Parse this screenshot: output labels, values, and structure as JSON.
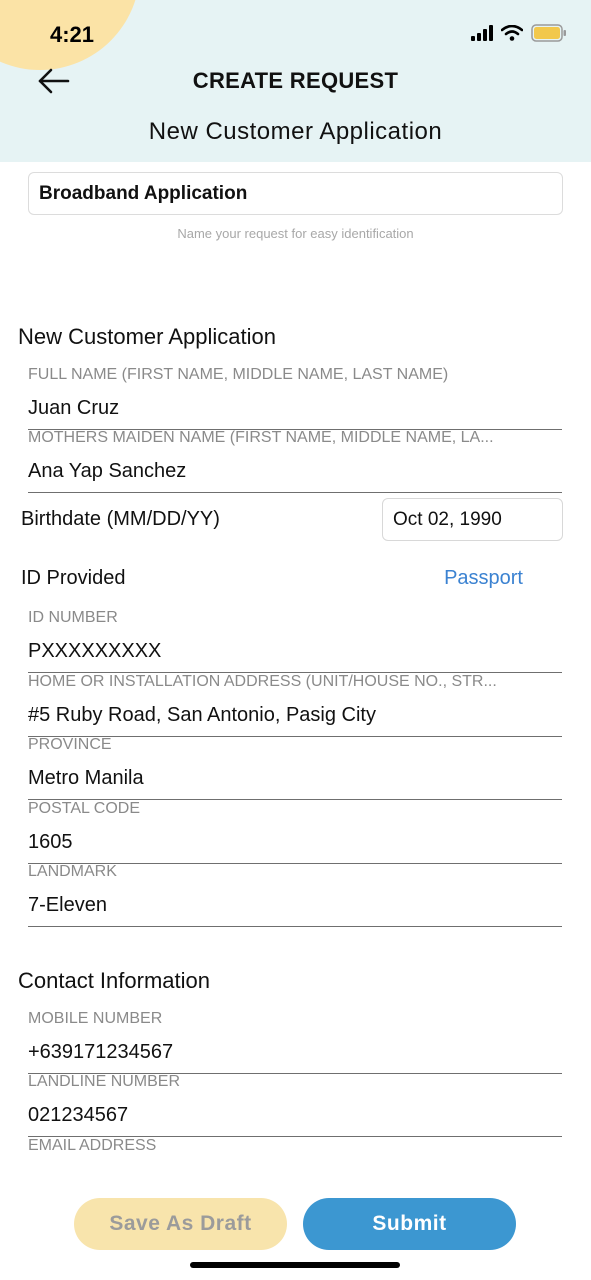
{
  "status": {
    "time": "4:21",
    "icons": [
      "signal-icon",
      "wifi-icon",
      "battery-icon"
    ]
  },
  "header": {
    "back_icon": "back-arrow-icon",
    "title": "CREATE REQUEST",
    "subtitle": "New Customer Application"
  },
  "request": {
    "name": "Broadband Application",
    "hint": "Name your request for easy identification"
  },
  "section_customer": {
    "title": "New Customer Application",
    "full_name": {
      "label": "FULL NAME (FIRST NAME, MIDDLE NAME, LAST NAME)",
      "value": "Juan Cruz"
    },
    "mothers_maiden": {
      "label": "MOTHERS MAIDEN NAME (FIRST NAME, MIDDLE NAME, LA...",
      "value": "Ana Yap Sanchez"
    },
    "birthdate": {
      "label": "Birthdate (MM/DD/YY)",
      "value": "Oct 02, 1990"
    },
    "id_provided": {
      "label": "ID Provided",
      "value": "Passport"
    },
    "id_number": {
      "label": "ID NUMBER",
      "value": "PXXXXXXXXX"
    },
    "address": {
      "label": "HOME OR INSTALLATION ADDRESS (UNIT/HOUSE NO., STR...",
      "value": "#5 Ruby Road, San Antonio, Pasig City"
    },
    "province": {
      "label": "PROVINCE",
      "value": "Metro Manila"
    },
    "postal_code": {
      "label": "POSTAL CODE",
      "value": "1605"
    },
    "landmark": {
      "label": "LANDMARK",
      "value": "7-Eleven"
    }
  },
  "section_contact": {
    "title": "Contact Information",
    "mobile": {
      "label": "MOBILE NUMBER",
      "value": "+639171234567"
    },
    "landline": {
      "label": "LANDLINE NUMBER",
      "value": "021234567"
    },
    "email": {
      "label": "EMAIL ADDRESS",
      "value": ""
    }
  },
  "actions": {
    "save_draft": "Save As Draft",
    "submit": "Submit"
  },
  "colors": {
    "header_bg": "#e6f3f4",
    "accent_yellow": "#f8e4ac",
    "accent_blue": "#3c97d1",
    "link_blue": "#3b82d1"
  }
}
